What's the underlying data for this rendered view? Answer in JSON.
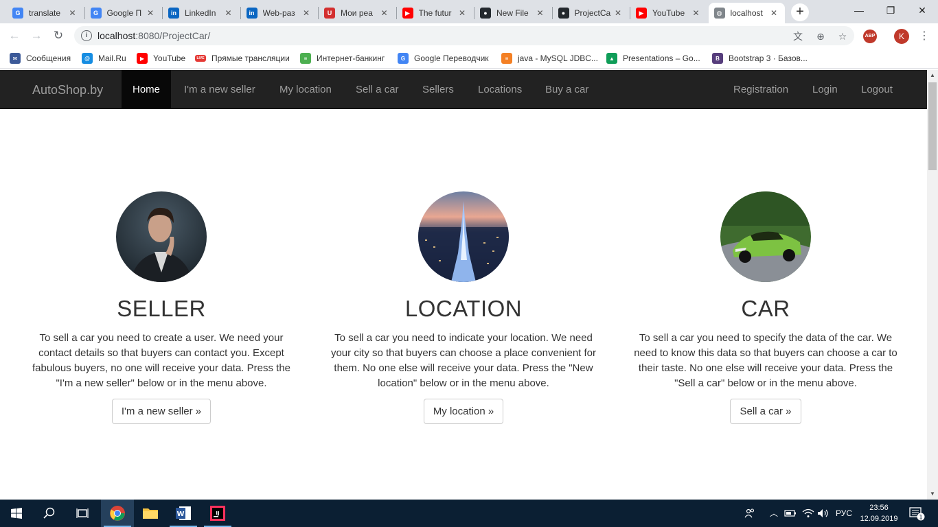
{
  "browser": {
    "tabs": [
      {
        "title": "translate",
        "icon": "google-translate-icon",
        "color": "#4285f4",
        "glyph": "G"
      },
      {
        "title": "Google П",
        "icon": "google-translate-icon",
        "color": "#4285f4",
        "glyph": "G"
      },
      {
        "title": "LinkedIn",
        "icon": "linkedin-icon",
        "color": "#0a66c2",
        "glyph": "in"
      },
      {
        "title": "Web-раз",
        "icon": "linkedin-icon",
        "color": "#0a66c2",
        "glyph": "in"
      },
      {
        "title": "Мои реа",
        "icon": "shield-icon",
        "color": "#d32f2f",
        "glyph": "U"
      },
      {
        "title": "The futur",
        "icon": "youtube-icon",
        "color": "#ff0000",
        "glyph": "▶"
      },
      {
        "title": "New File",
        "icon": "github-icon",
        "color": "#24292e",
        "glyph": "●"
      },
      {
        "title": "ProjectCa",
        "icon": "github-icon",
        "color": "#24292e",
        "glyph": "●"
      },
      {
        "title": "YouTube",
        "icon": "youtube-icon",
        "color": "#ff0000",
        "glyph": "▶"
      },
      {
        "title": "localhost",
        "icon": "globe-icon",
        "color": "#80868b",
        "glyph": "◍",
        "active": true
      }
    ],
    "url_host": "localhost",
    "url_rest": ":8080/ProjectCar/",
    "profile_initial": "K",
    "abp_label": "ABP",
    "bookmarks": [
      {
        "label": "Сообщения",
        "icon": "chat-icon",
        "color": "#3b5998",
        "glyph": "✉"
      },
      {
        "label": "Mail.Ru",
        "icon": "mailru-icon",
        "color": "#168de2",
        "glyph": "@"
      },
      {
        "label": "YouTube",
        "icon": "youtube-icon",
        "color": "#ff0000",
        "glyph": "▶"
      },
      {
        "label": "Прямые трансляции",
        "icon": "live-icon",
        "color": "#e53935",
        "glyph": "LIVE"
      },
      {
        "label": "Интернет-банкинг",
        "icon": "bank-icon",
        "color": "#4caf50",
        "glyph": "≡"
      },
      {
        "label": "Google Переводчик",
        "icon": "google-translate-icon",
        "color": "#4285f4",
        "glyph": "G"
      },
      {
        "label": "java - MySQL JDBC...",
        "icon": "stackoverflow-icon",
        "color": "#f48024",
        "glyph": "≡"
      },
      {
        "label": "Presentations – Go...",
        "icon": "google-drive-icon",
        "color": "#0f9d58",
        "glyph": "▲"
      },
      {
        "label": "Bootstrap 3 · Базов...",
        "icon": "bootstrap-icon",
        "color": "#563d7c",
        "glyph": "B"
      }
    ]
  },
  "navbar": {
    "brand": "AutoShop.by",
    "left_links": [
      "Home",
      "I'm a new seller",
      "My location",
      "Sell a car",
      "Sellers",
      "Locations",
      "Buy a car"
    ],
    "active_index": 0,
    "right_links": [
      "Registration",
      "Login",
      "Logout"
    ]
  },
  "sections": [
    {
      "heading": "SELLER",
      "text": "To sell a car you need to create a user. We need your contact details so that buyers can contact you. Except fabulous buyers, no one will receive your data. Press the \"I'm a new seller\" below or in the menu above.",
      "button": "I'm a new seller »"
    },
    {
      "heading": "LOCATION",
      "text": "To sell a car you need to indicate your location. We need your city so that buyers can choose a place convenient for them. No one else will receive your data. Press the \"New location\" below or in the menu above.",
      "button": "My location »"
    },
    {
      "heading": "CAR",
      "text": "To sell a car you need to specify the data of the car. We need to know this data so that buyers can choose a car to their taste. No one else will receive your data. Press the \"Sell a car\" below or in the menu above.",
      "button": "Sell a car »"
    }
  ],
  "taskbar": {
    "language": "РУС",
    "time": "23:56",
    "date": "12.09.2019",
    "notification_count": "1"
  }
}
